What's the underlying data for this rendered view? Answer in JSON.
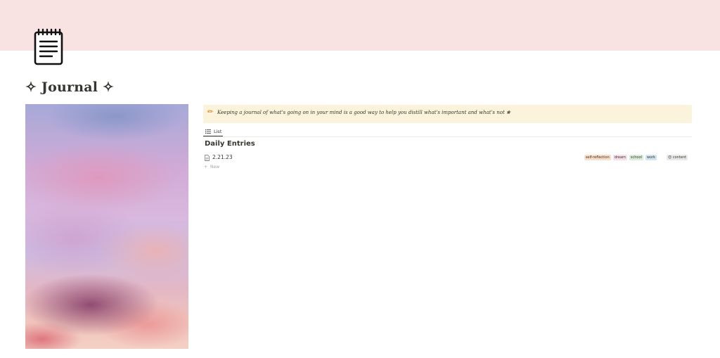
{
  "page": {
    "icon": "notepad-icon",
    "title": "✧ Journal ✧",
    "cover_color": "#f9e2e2",
    "image": "pink-sky-clouds-image"
  },
  "callout": {
    "icon": "pencil-icon",
    "text": "Keeping a journal of what's going on in your mind is a good way to help you distill what's important and what's not ❀",
    "background": "#fbf3db"
  },
  "database": {
    "view_tab_label": "List",
    "view_tab_icon": "list-icon",
    "title": "Daily Entries",
    "rows": [
      {
        "icon": "document-icon",
        "title": "2.21.23",
        "tags": [
          {
            "label": "self-reflection",
            "color": "#fadec9"
          },
          {
            "label": "dream",
            "color": "#f5e0e9"
          },
          {
            "label": "school",
            "color": "#dbeddb"
          },
          {
            "label": "work",
            "color": "#d3e5ef"
          }
        ],
        "status": {
          "label": "😌 content",
          "color": "#e9e9e7"
        }
      }
    ],
    "new_label": "New"
  }
}
